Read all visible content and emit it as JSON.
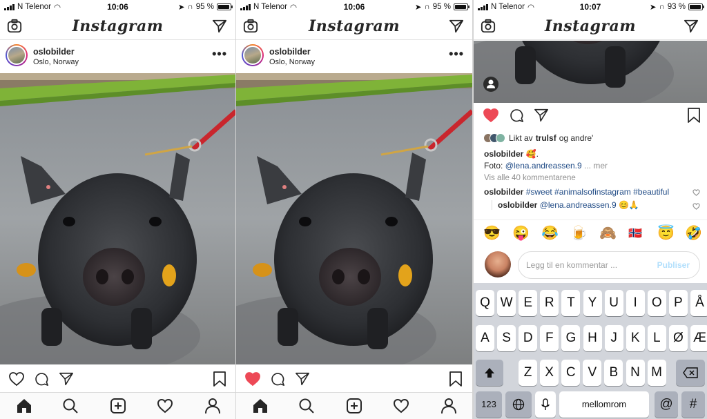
{
  "screens": [
    {
      "status": {
        "carrier": "N Telenor",
        "time": "10:06",
        "battery": "95 %",
        "battery_level": 0.95
      },
      "header": {
        "logo": "Instagram"
      },
      "post": {
        "username": "oslobilder",
        "location": "Oslo, Norway",
        "more": "•••",
        "liked": false
      }
    },
    {
      "status": {
        "carrier": "N Telenor",
        "time": "10:06",
        "battery": "95 %",
        "battery_level": 0.95
      },
      "header": {
        "logo": "Instagram"
      },
      "post": {
        "username": "oslobilder",
        "location": "Oslo, Norway",
        "more": "•••",
        "liked": true
      }
    },
    {
      "status": {
        "carrier": "N Telenor",
        "time": "10:07",
        "battery": "93 %",
        "battery_level": 0.93
      },
      "header": {
        "logo": "Instagram"
      },
      "post": {
        "liked": true,
        "likes_prefix": "Likt av",
        "likes_user": "trulsf",
        "likes_suffix": "og andre'",
        "caption_user": "oslobilder",
        "caption_text": "🥰.",
        "caption_line2_prefix": "Foto:",
        "caption_mention": "@lena.andreassen.9",
        "caption_more": "... mer",
        "view_all": "Vis alle 40 kommentarene",
        "comments": [
          {
            "user": "oslobilder",
            "text": "#sweet #animalsofinstagram #beautiful"
          }
        ],
        "replies": [
          {
            "user": "oslobilder",
            "mention": "@lena.andreassen.9",
            "emoji": "😊🙏"
          }
        ]
      },
      "emoji_bar": [
        "😎",
        "😜",
        "😂",
        "🍺",
        "🙈",
        "🇳🇴",
        "😇",
        "🤣"
      ],
      "comment_box": {
        "placeholder": "Legg til en kommentar ...",
        "publish": "Publiser"
      },
      "keyboard": {
        "row1": [
          "Q",
          "W",
          "E",
          "R",
          "T",
          "Y",
          "U",
          "I",
          "O",
          "P",
          "Å"
        ],
        "row2": [
          "A",
          "S",
          "D",
          "F",
          "G",
          "H",
          "J",
          "K",
          "L",
          "Ø",
          "Æ"
        ],
        "row3": [
          "Z",
          "X",
          "C",
          "V",
          "B",
          "N",
          "M"
        ],
        "numbers": "123",
        "space": "mellomrom",
        "at": "@",
        "hash": "#"
      }
    }
  ],
  "icons": {
    "camera": "camera-icon",
    "direct": "paper-plane-icon",
    "heart": "heart-icon",
    "comment": "comment-icon",
    "share": "share-icon",
    "bookmark": "bookmark-icon",
    "home": "home-icon",
    "search": "search-icon",
    "add": "add-post-icon",
    "activity": "heart-outline-icon",
    "profile": "profile-icon"
  },
  "colors": {
    "like_red": "#ed4956",
    "link_blue": "#1f4a85",
    "publish_disabled": "#b2dffc",
    "keyboard_bg": "#d2d5db"
  }
}
